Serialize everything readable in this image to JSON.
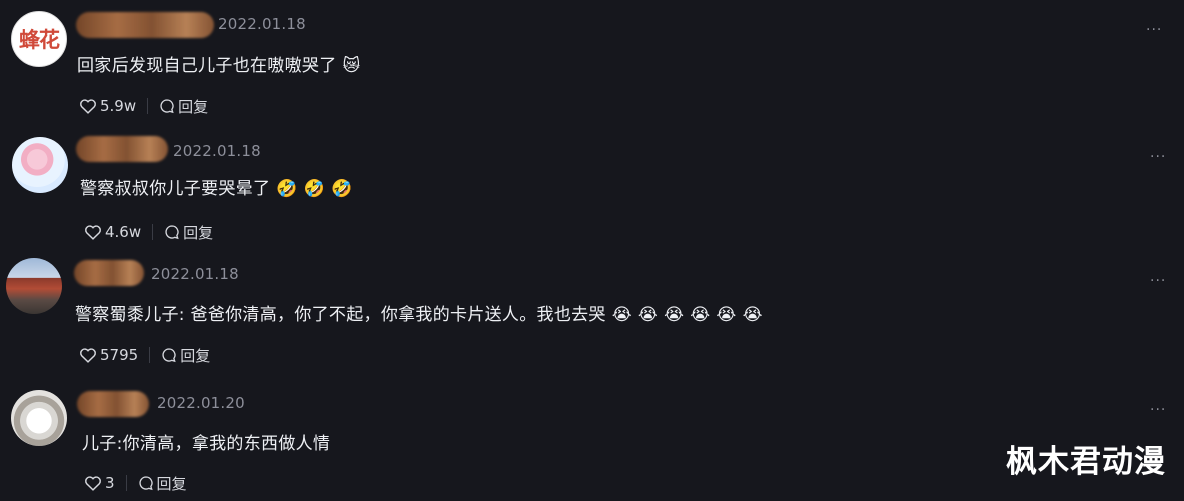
{
  "comments": [
    {
      "date": "2022.01.18",
      "avatar_text": "蜂花",
      "text": "回家后发现自己儿子也在嗷嗷哭了",
      "emojis": [
        "😿"
      ],
      "likes": "5.9w",
      "reply_label": "回复",
      "more_label": "···"
    },
    {
      "date": "2022.01.18",
      "text": "警察叔叔你儿子要哭晕了",
      "emojis": [
        "🤣",
        "🤣",
        "🤣"
      ],
      "likes": "4.6w",
      "reply_label": "回复",
      "more_label": "···"
    },
    {
      "date": "2022.01.18",
      "text": "警察蜀黍儿子: 爸爸你清高，你了不起，你拿我的卡片送人。我也去哭",
      "emojis": [
        "😭",
        "😭",
        "😭",
        "😭",
        "😭",
        "😭"
      ],
      "likes": "5795",
      "reply_label": "回复",
      "more_label": "···"
    },
    {
      "date": "2022.01.20",
      "text": "儿子:你清高，拿我的东西做人情",
      "emojis": [],
      "likes": "3",
      "reply_label": "回复",
      "more_label": "···"
    }
  ],
  "watermark": "枫木君动漫",
  "colors": {
    "background": "#16171d",
    "text": "#eef0f4",
    "muted": "#8d8f9a"
  },
  "icons": {
    "like": "heart-outline-icon",
    "reply": "speech-bubble-icon",
    "more": "ellipsis-icon"
  }
}
